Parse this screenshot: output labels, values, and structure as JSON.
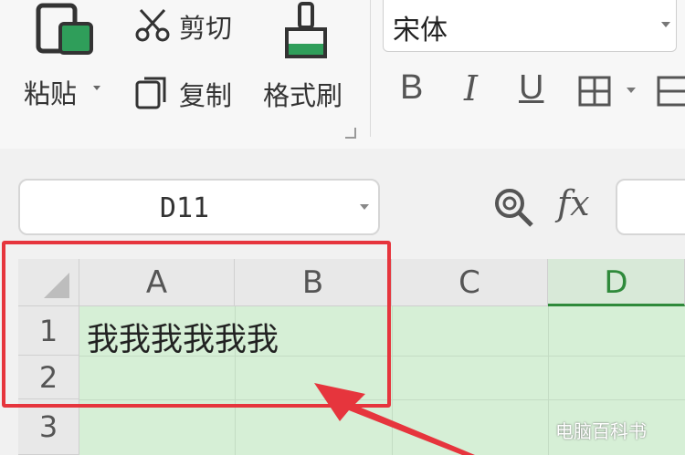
{
  "ribbon": {
    "paste": {
      "label": "粘贴"
    },
    "cut": {
      "label": "剪切"
    },
    "copy": {
      "label": "复制"
    },
    "format_painter": {
      "label": "格式刷"
    },
    "font_name": "宋体",
    "bold_label": "B",
    "italic_label": "I",
    "underline_label": "U"
  },
  "formula_bar": {
    "name_box_value": "D11",
    "fx_label": "fx"
  },
  "sheet": {
    "columns": [
      "A",
      "B",
      "C",
      "D"
    ],
    "active_column": "D",
    "rows": [
      "1",
      "2",
      "3"
    ],
    "cells": {
      "A1": "我我我我我我"
    }
  },
  "annotation": {
    "highlight_color": "#e6353d",
    "arrow_color": "#e6353d"
  },
  "watermark": "电脑百科书",
  "colors": {
    "selection_fill": "#d6efd6",
    "accent_green": "#2f8a3b"
  }
}
